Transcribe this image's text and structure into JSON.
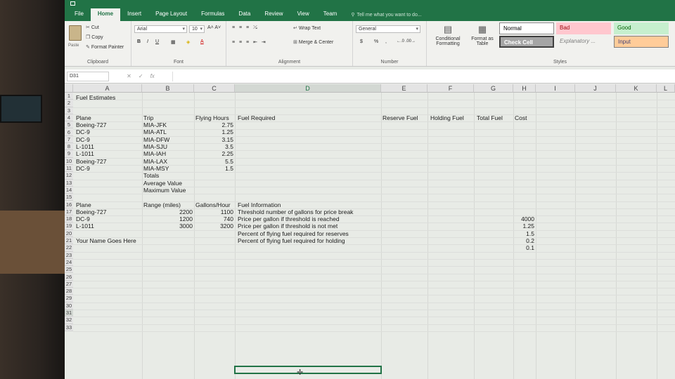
{
  "ribbon": {
    "tabs": [
      "File",
      "Home",
      "Insert",
      "Page Layout",
      "Formulas",
      "Data",
      "Review",
      "View",
      "Team"
    ],
    "active_tab": "Home",
    "tell_me": "Tell me what you want to do...",
    "clipboard": {
      "paste": "Paste",
      "cut": "Cut",
      "copy": "Copy",
      "format_painter": "Format Painter",
      "label": "Clipboard"
    },
    "font": {
      "name": "Arial",
      "size": "10",
      "label": "Font"
    },
    "alignment": {
      "wrap_text": "Wrap Text",
      "merge_center": "Merge & Center",
      "label": "Alignment"
    },
    "number": {
      "format": "General",
      "currency": "$",
      "percent": "%",
      "comma": ",",
      "label": "Number"
    },
    "styles_group": {
      "conditional": "Conditional Formatting",
      "format_table": "Format as Table",
      "label": "Styles"
    },
    "styles": {
      "normal": "Normal",
      "bad": "Bad",
      "good": "Good",
      "check_cell": "Check Cell",
      "explanatory": "Explanatory ...",
      "input": "Input"
    },
    "colors": {
      "excel_green": "#217346",
      "bad_bg": "#ffc7ce",
      "good_bg": "#c6efce",
      "check_bg": "#a5a5a5",
      "input_bg": "#ffcc99"
    }
  },
  "formula_bar": {
    "name_box": "D31",
    "fx": "fx",
    "value": ""
  },
  "columns": [
    "A",
    "B",
    "C",
    "D",
    "E",
    "F",
    "G",
    "H",
    "I",
    "J",
    "K",
    "L"
  ],
  "selected_column": "D",
  "rows": [
    "1",
    "2",
    "3",
    "4",
    "5",
    "6",
    "7",
    "8",
    "9",
    "10",
    "11",
    "12",
    "13",
    "14",
    "15",
    "16",
    "17",
    "18",
    "19",
    "20",
    "21",
    "22",
    "23",
    "24",
    "25",
    "26",
    "27",
    "28",
    "29",
    "30",
    "31",
    "32",
    "33"
  ],
  "cells": {
    "a1": "Fuel Estimates",
    "a3": "Plane",
    "b3": "Trip",
    "c3": "Flying Hours",
    "d3": "Fuel Required",
    "e3": "Reserve Fuel",
    "f3": "Holding Fuel",
    "g3": "Total Fuel",
    "h3": "Cost",
    "a4": "Boeing-727",
    "b4": "MIA-JFK",
    "c4": "2.75",
    "a5": "DC-9",
    "b5": "MIA-ATL",
    "c5": "1.25",
    "a6": "DC-9",
    "b6": "MIA-DFW",
    "c6": "3.15",
    "a7": "L-1011",
    "b7": "MIA-SJU",
    "c7": "3.5",
    "a8": "L-1011",
    "b8": "MIA-IAH",
    "c8": "2.25",
    "a9": "Boeing-727",
    "b9": "MIA-LAX",
    "c9": "5.5",
    "a10": "DC-9",
    "b10": "MIA-MSY",
    "c10": "1.5",
    "b11": "Totals",
    "b12": "Average Value",
    "b13": "Maximum Value",
    "a15": "Plane",
    "b15": "Range (miles)",
    "c15": "Gallons/Hour",
    "d15": "Fuel Information",
    "a16": "Boeing-727",
    "b16": "2200",
    "c16": "1100",
    "d16": "Threshold number of gallons for price break",
    "a17": "DC-9",
    "b17": "1200",
    "c17": "740",
    "d17": "Price per gallon if threshold is reached",
    "h17": "4000",
    "a18": "L-1011",
    "b18": "3000",
    "c18": "3200",
    "d18": "Price per gallon if threshold is not met",
    "h18": "1.25",
    "d19": "Percent of flying fuel required for reserves",
    "h19": "1.5",
    "a20": "Your Name Goes Here",
    "d20": "Percent of flying fuel required for holding",
    "h20": "0.2",
    "h21": "0.1"
  }
}
